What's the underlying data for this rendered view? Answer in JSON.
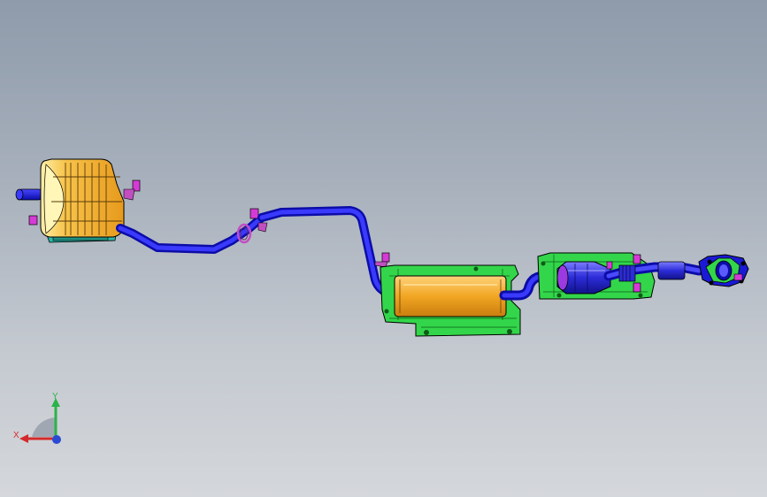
{
  "viewport": {
    "background_top": "#8f9bab",
    "background_bottom": "#d4d7db"
  },
  "model": {
    "components": [
      "rear-muffler",
      "tailpipe",
      "rear-pipe",
      "flex-clamp",
      "mid-pipe",
      "center-muffler",
      "front-pipe",
      "catalytic-converter",
      "manifold-flange",
      "hanger-brackets"
    ],
    "colors": {
      "pipe": "#1a1ad6",
      "muffler": "#f2a623",
      "heat_shield": "#33d64a",
      "hanger": "#d63ad6",
      "converter": "#7a2ad6"
    }
  },
  "triad": {
    "x_label": "X",
    "y_label": "Y",
    "x_color": "#d42a2a",
    "y_color": "#2ab34a",
    "z_color": "#2a4ad4"
  }
}
